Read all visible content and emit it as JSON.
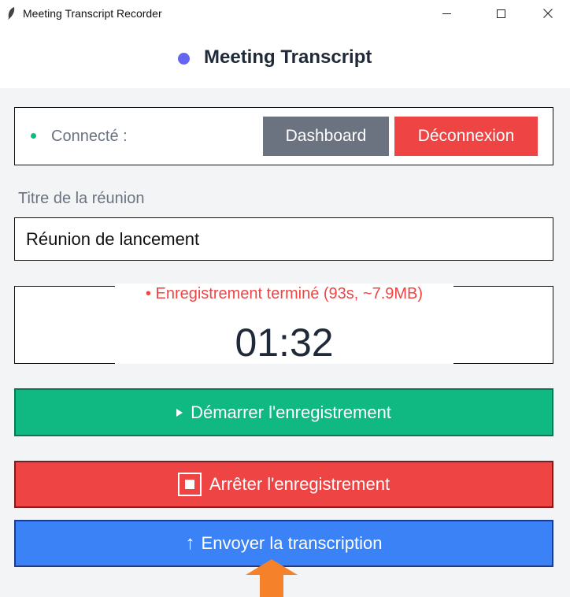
{
  "window": {
    "title": "Meeting Transcript Recorder"
  },
  "header": {
    "title": "Meeting Transcript",
    "dot_color": "#6366f1"
  },
  "connection": {
    "label": "Connecté :",
    "status_color": "#10b981",
    "dashboard_label": "Dashboard",
    "logout_label": "Déconnexion"
  },
  "meeting": {
    "title_label": "Titre de la réunion",
    "title_value": "Réunion de lancement"
  },
  "status": {
    "message": "•  Enregistrement terminé (93s, ~7.9MB)",
    "timer": "01:32"
  },
  "actions": {
    "start_label": "Démarrer l'enregistrement",
    "stop_label": "Arrêter l'enregistrement",
    "upload_label": "Envoyer la transcription",
    "upload_icon": "↑"
  },
  "colors": {
    "start": "#10b981",
    "stop": "#ef4444",
    "upload": "#3b82f6",
    "dashboard": "#6b7280",
    "logout": "#ef4444",
    "cursor": "#f5822a"
  }
}
